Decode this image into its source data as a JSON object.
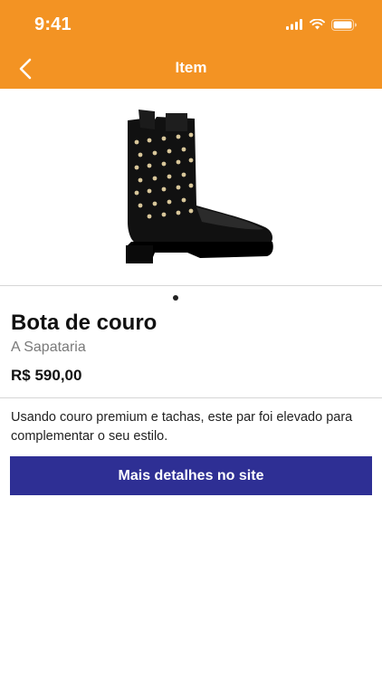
{
  "status_bar": {
    "time": "9:41"
  },
  "nav": {
    "title": "Item"
  },
  "gallery": {
    "image_subject": "black leather ankle boot with studs",
    "page_count": 1,
    "current_page": 1
  },
  "product": {
    "name": "Bota de couro",
    "store": "A Sapataria",
    "price": "R$ 590,00",
    "description": "Usando couro premium e tachas, este par foi elevado para complementar o seu estilo."
  },
  "actions": {
    "details_label": "Mais detalhes no site"
  },
  "colors": {
    "header": "#f39323",
    "button": "#2e2f94"
  }
}
